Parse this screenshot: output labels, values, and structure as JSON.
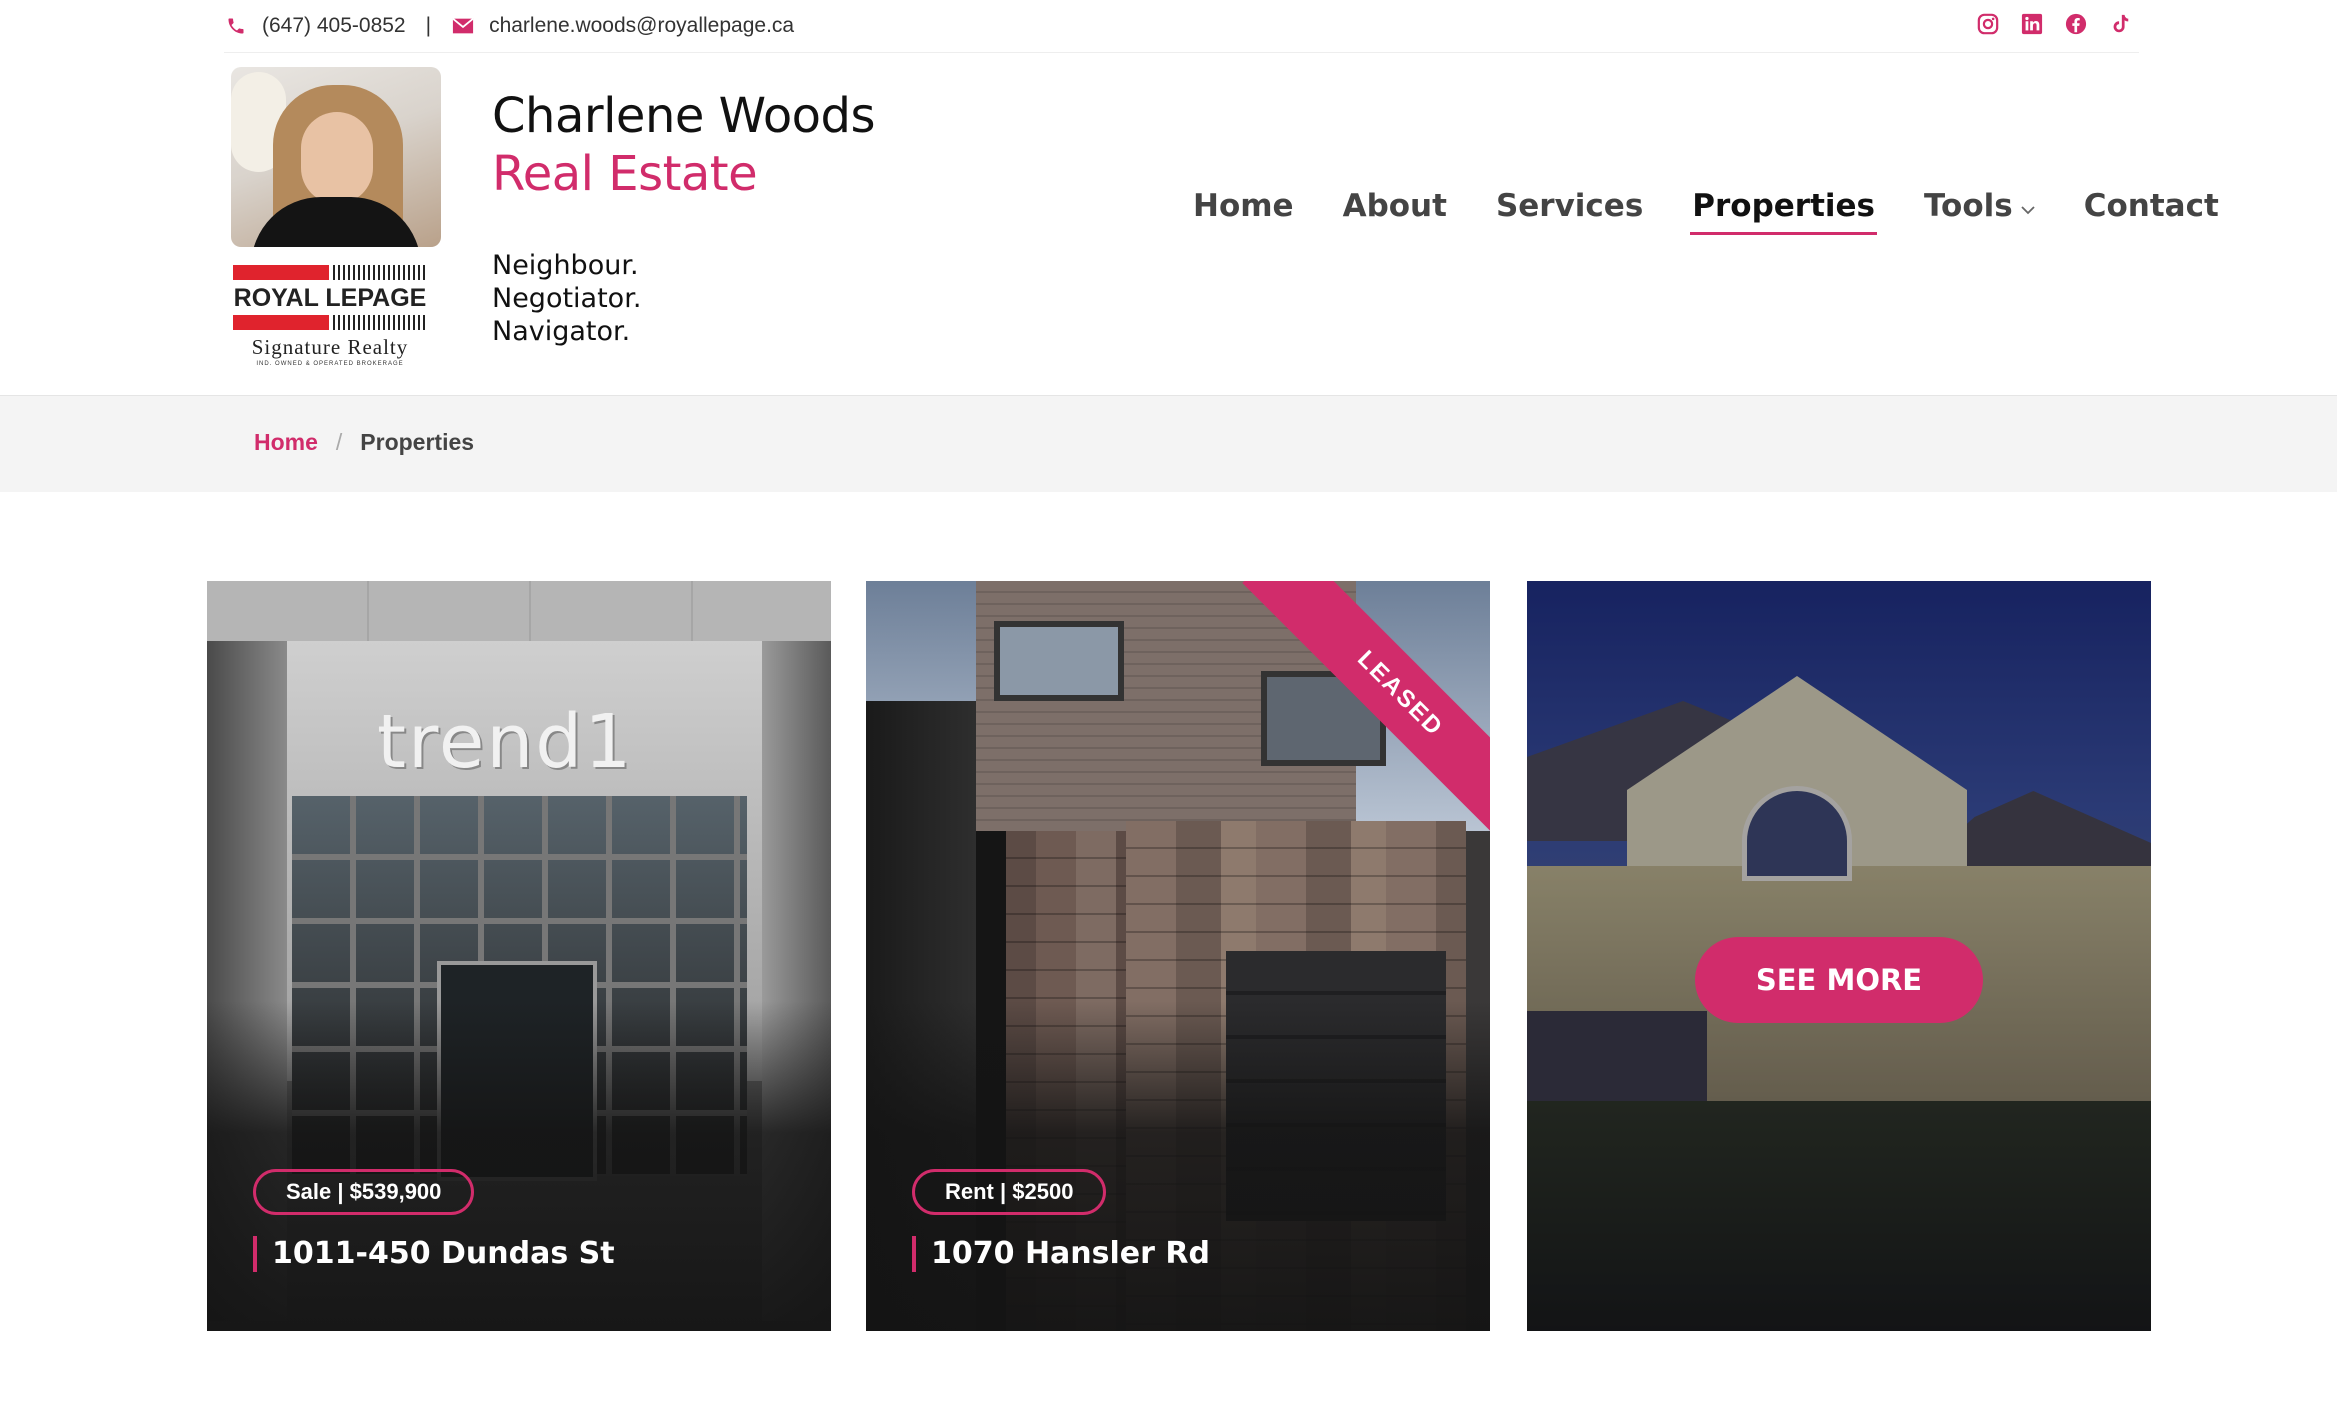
{
  "topbar": {
    "phone": "(647) 405-0852",
    "separator": "|",
    "email": "charlene.woods@royallepage.ca",
    "social_icons": [
      "instagram-icon",
      "linkedin-icon",
      "facebook-icon",
      "tiktok-icon"
    ]
  },
  "header": {
    "name_line1": "Charlene Woods",
    "name_line2": "Real Estate",
    "taglines": [
      "Neighbour.",
      "Negotiator.",
      "Navigator."
    ],
    "logo": {
      "brand": "ROYAL LEPAGE",
      "sub": "Signature Realty",
      "tiny": "IND. OWNED & OPERATED BROKERAGE"
    }
  },
  "nav": {
    "items": [
      {
        "label": "Home"
      },
      {
        "label": "About"
      },
      {
        "label": "Services"
      },
      {
        "label": "Properties",
        "active": true
      },
      {
        "label": "Tools",
        "dropdown": true
      },
      {
        "label": "Contact"
      }
    ]
  },
  "breadcrumb": {
    "home": "Home",
    "separator": "/",
    "current": "Properties"
  },
  "cards": [
    {
      "sign": "trend1",
      "badge": "Sale | $539,900",
      "address": "1011-450 Dundas St"
    },
    {
      "badge": "Rent | $2500",
      "address": "1070 Hansler Rd",
      "banner": "LEASED"
    },
    {
      "button": "SEE MORE"
    }
  ],
  "colors": {
    "accent": "#d12c6b",
    "breadcrumb_bg": "#f4f4f4",
    "text_dark": "#111111"
  }
}
